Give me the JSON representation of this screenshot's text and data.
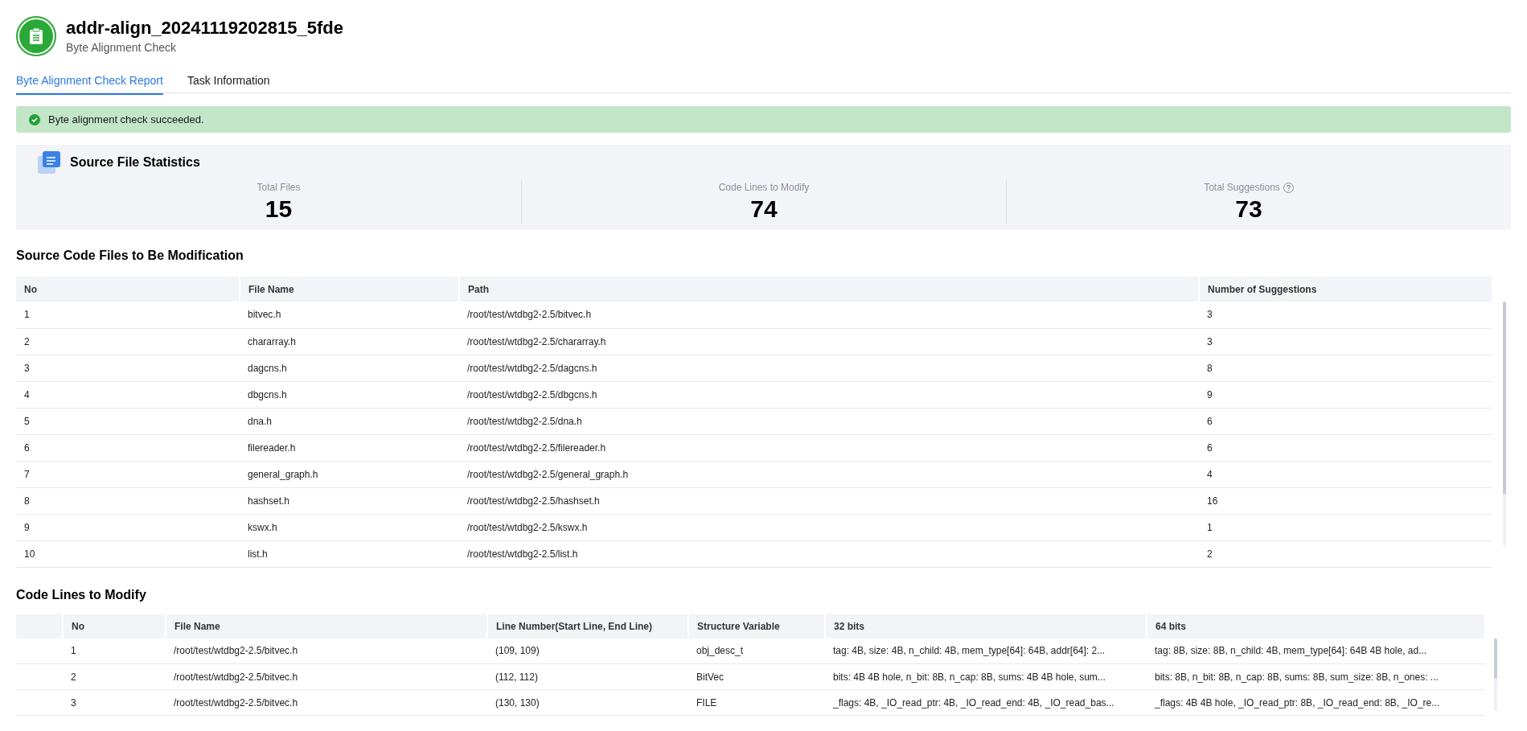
{
  "header": {
    "title": "addr-align_20241119202815_5fde",
    "subtitle": "Byte Alignment Check"
  },
  "tabs": [
    {
      "label": "Byte Alignment Check Report",
      "selected": true
    },
    {
      "label": "Task Information",
      "selected": false
    }
  ],
  "alert": {
    "message": "Byte alignment check succeeded."
  },
  "statistics": {
    "title": "Source File Statistics",
    "items": [
      {
        "label": "Total Files",
        "value": "15",
        "help": false
      },
      {
        "label": "Code Lines to Modify",
        "value": "74",
        "help": false
      },
      {
        "label": "Total Suggestions",
        "value": "73",
        "help": true
      }
    ]
  },
  "files_table": {
    "title": "Source Code Files to Be Modification",
    "columns": [
      "No",
      "File Name",
      "Path",
      "Number of Suggestions"
    ],
    "rows": [
      [
        "1",
        "bitvec.h",
        "/root/test/wtdbg2-2.5/bitvec.h",
        "3"
      ],
      [
        "2",
        "chararray.h",
        "/root/test/wtdbg2-2.5/chararray.h",
        "3"
      ],
      [
        "3",
        "dagcns.h",
        "/root/test/wtdbg2-2.5/dagcns.h",
        "8"
      ],
      [
        "4",
        "dbgcns.h",
        "/root/test/wtdbg2-2.5/dbgcns.h",
        "9"
      ],
      [
        "5",
        "dna.h",
        "/root/test/wtdbg2-2.5/dna.h",
        "6"
      ],
      [
        "6",
        "filereader.h",
        "/root/test/wtdbg2-2.5/filereader.h",
        "6"
      ],
      [
        "7",
        "general_graph.h",
        "/root/test/wtdbg2-2.5/general_graph.h",
        "4"
      ],
      [
        "8",
        "hashset.h",
        "/root/test/wtdbg2-2.5/hashset.h",
        "16"
      ],
      [
        "9",
        "kswx.h",
        "/root/test/wtdbg2-2.5/kswx.h",
        "1"
      ],
      [
        "10",
        "list.h",
        "/root/test/wtdbg2-2.5/list.h",
        "2"
      ]
    ]
  },
  "lines_table": {
    "title": "Code Lines to Modify",
    "columns": [
      "No",
      "File Name",
      "Line Number(Start Line, End Line)",
      "Structure Variable",
      "32 bits",
      "64 bits"
    ],
    "rows": [
      [
        "1",
        "/root/test/wtdbg2-2.5/bitvec.h",
        "(109, 109)",
        "obj_desc_t",
        "tag: 4B, size: 4B, n_child: 4B, mem_type[64]: 64B, addr[64]: 2...",
        "tag: 8B, size: 8B, n_child: 4B, mem_type[64]: 64B 4B hole, ad..."
      ],
      [
        "2",
        "/root/test/wtdbg2-2.5/bitvec.h",
        "(112, 112)",
        "BitVec",
        "bits: 4B 4B hole, n_bit: 8B, n_cap: 8B, sums: 4B 4B hole, sum...",
        "bits: 8B, n_bit: 8B, n_cap: 8B, sums: 8B, sum_size: 8B, n_ones: ..."
      ],
      [
        "3",
        "/root/test/wtdbg2-2.5/bitvec.h",
        "(130, 130)",
        "FILE",
        "_flags: 4B, _IO_read_ptr: 4B, _IO_read_end: 4B, _IO_read_bas...",
        "_flags: 4B 4B hole, _IO_read_ptr: 8B, _IO_read_end: 8B, _IO_re..."
      ]
    ]
  }
}
